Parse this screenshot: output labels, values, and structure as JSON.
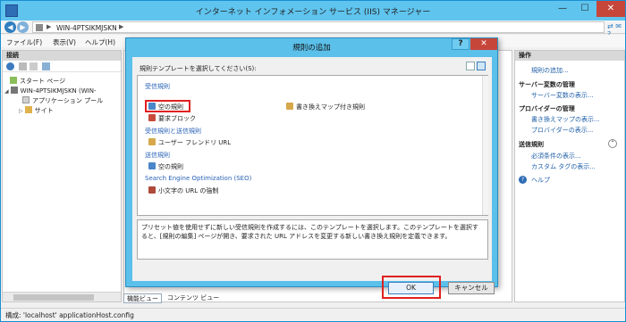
{
  "window": {
    "title": "インターネット インフォメーション サービス (IIS) マネージャー"
  },
  "address": {
    "breadcrumb": "WIN-4PTSIKMJSKN"
  },
  "menu": {
    "items": [
      "ファイル(F)",
      "表示(V)",
      "ヘルプ(H)"
    ]
  },
  "connections": {
    "title": "接続",
    "tree": [
      {
        "label": "スタート ページ"
      },
      {
        "label": "WIN-4PTSIKMJSKN (WIN-"
      },
      {
        "label": "アプリケーション プール"
      },
      {
        "label": "サイト"
      }
    ]
  },
  "actions": {
    "title": "操作",
    "add_rule": "規則の追加...",
    "sec_server_vars": "サーバー変数の管理",
    "show_server_vars": "サーバー変数の表示...",
    "sec_providers": "プロバイダーの管理",
    "show_rewrite_maps": "書き換えマップの表示...",
    "show_providers": "プロバイダーの表示...",
    "sec_outbound": "送信規則",
    "show_preconditions": "必須条件の表示...",
    "show_custom_tags": "カスタム タグの表示...",
    "help": "ヘルプ"
  },
  "view_tabs": {
    "features": "機能ビュー",
    "content": "コンテンツ ビュー"
  },
  "status": {
    "text": "構成: 'localhost' applicationHost.config"
  },
  "dialog": {
    "title": "規則の追加",
    "help": "?",
    "close": "✕",
    "prompt": "規則テンプレートを選択してください(S):",
    "groups": {
      "inbound": "受信規則",
      "inbound_outbound": "受信規則と送信規則",
      "outbound": "送信規則",
      "seo": "Search Engine Optimization (SEO)"
    },
    "items": {
      "blank_rule": "空の規則",
      "rewrite_map_rule": "書き換えマップ付き規則",
      "request_block": "要求ブロック",
      "friendly_url": "ユーザー フレンドリ URL",
      "blank_outbound": "空の規則",
      "lowercase_url": "小文字の URL の強制"
    },
    "description": "プリセット値を使用せずに新しい受信規則を作成するには、このテンプレートを選択します。このテンプレートを選択すると、[規則の編集] ページが開き、要求された URL アドレスを変更する新しい書き換え規則を定義できます。",
    "ok": "OK",
    "cancel": "キャンセル"
  },
  "colors": {
    "title_bar": "#5fc4ee",
    "highlight": "#e02020",
    "link": "#1f5fa8"
  }
}
